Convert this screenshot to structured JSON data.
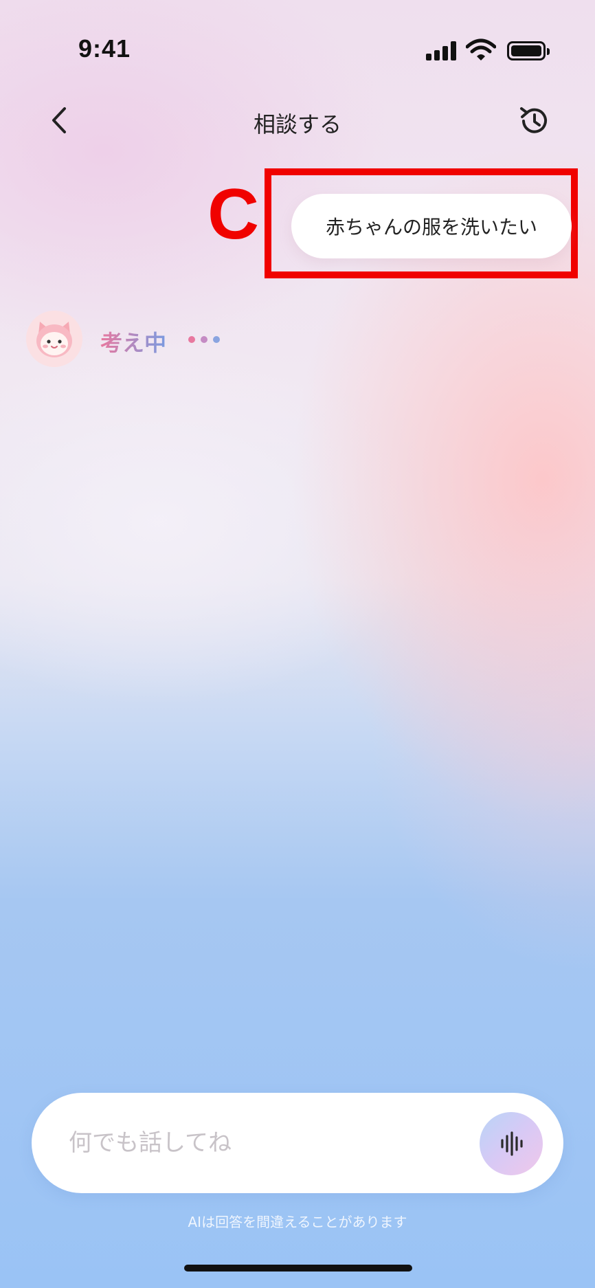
{
  "status_bar": {
    "time": "9:41"
  },
  "nav": {
    "title": "相談する",
    "back_icon": "chevron-left-icon",
    "history_icon": "history-icon"
  },
  "annotation": {
    "label": "C",
    "color": "#f00200"
  },
  "conversation": {
    "user_message": "赤ちゃんの服を洗いたい",
    "assistant": {
      "avatar_icon": "cat-mascot-avatar",
      "thinking_label": "考え中",
      "dot_colors": [
        "#e8789f",
        "#c58bc4",
        "#8aa4e0"
      ]
    }
  },
  "composer": {
    "placeholder": "何でも話してね",
    "voice_icon": "voice-waveform-icon"
  },
  "disclaimer": "AIは回答を間違えることがあります"
}
